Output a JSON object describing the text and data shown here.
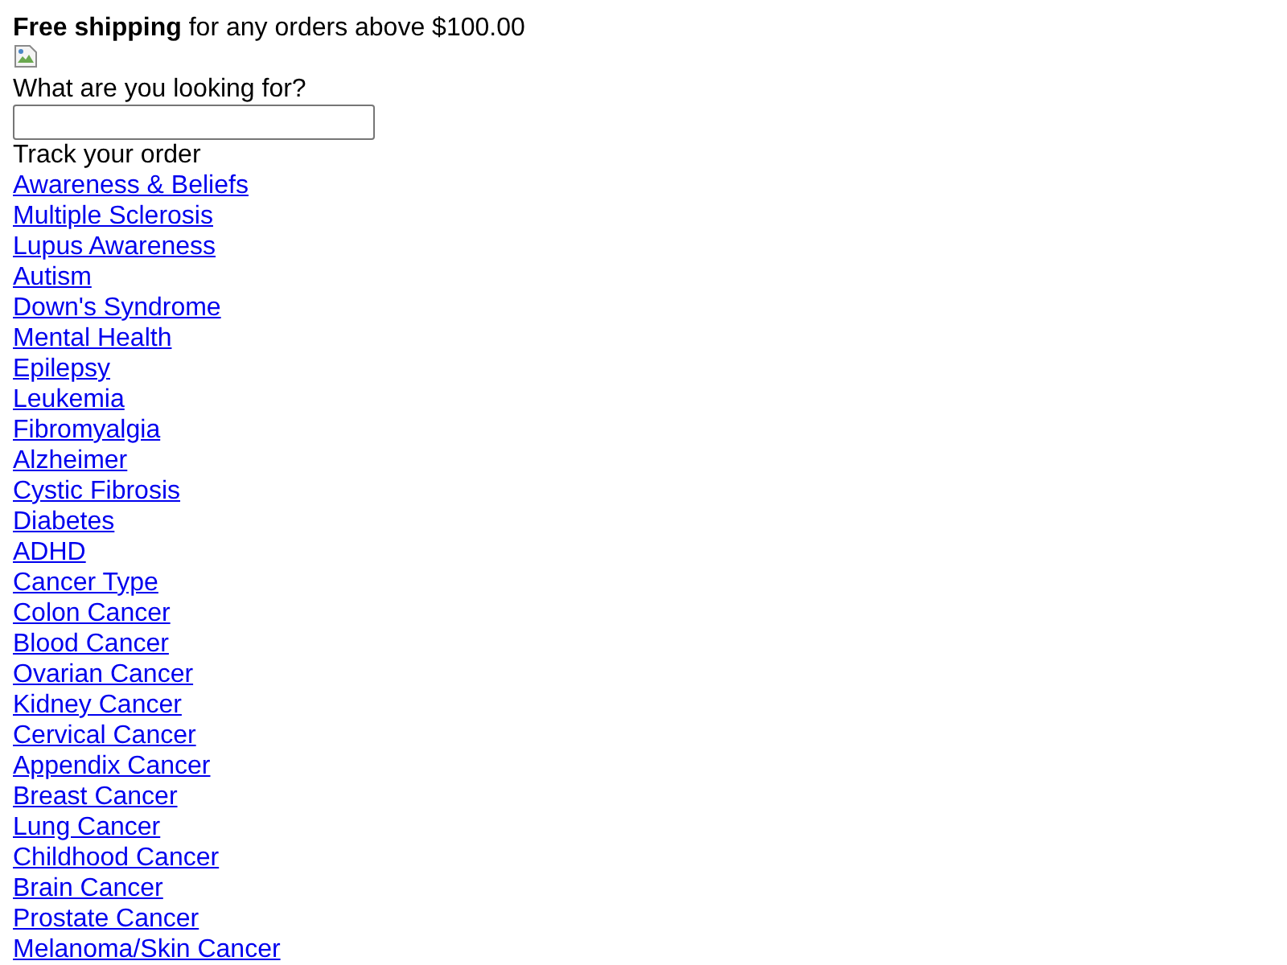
{
  "announcement": "**Free shipping** for any orders above $100.00",
  "search": {
    "label": "What are you looking for?"
  },
  "track_order": "Track your order",
  "links": [
    "Awareness & Beliefs",
    "Multiple Sclerosis",
    "Lupus Awareness",
    "Autism",
    "Down's Syndrome",
    "Mental Health",
    "Epilepsy",
    "Leukemia",
    "Fibromyalgia",
    "Alzheimer",
    "Cystic Fibrosis",
    "Diabetes",
    "ADHD",
    "Cancer Type",
    "Colon Cancer",
    "Blood Cancer",
    "Ovarian Cancer",
    "Kidney Cancer",
    "Cervical Cancer",
    "Appendix Cancer",
    "Breast Cancer",
    "Lung Cancer",
    "Childhood Cancer",
    "Brain Cancer",
    "Prostate Cancer",
    "Melanoma/Skin Cancer"
  ]
}
